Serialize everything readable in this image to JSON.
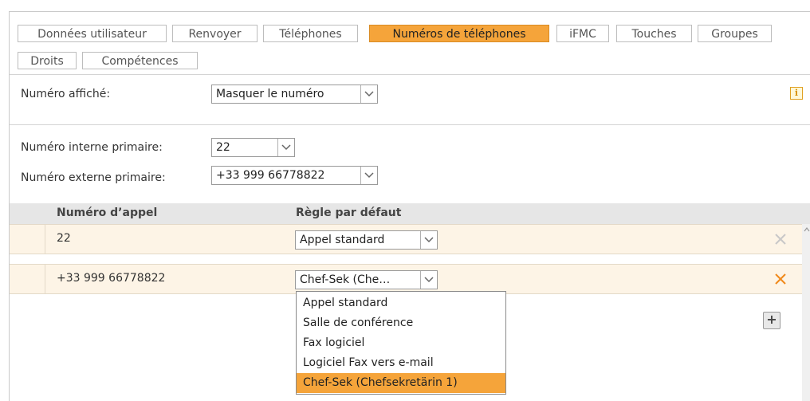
{
  "tabs": [
    {
      "label": "Données utilisateur"
    },
    {
      "label": "Renvoyer"
    },
    {
      "label": "Téléphones"
    },
    {
      "label": "Numéros de téléphones",
      "active": true
    },
    {
      "label": "iFMC"
    },
    {
      "label": "Touches"
    },
    {
      "label": "Groupes"
    },
    {
      "label": "Droits"
    },
    {
      "label": "Compétences"
    }
  ],
  "caller_id": {
    "label": "Numéro affiché:",
    "value": "Masquer le numéro"
  },
  "primary": {
    "internal_label": "Numéro interne primaire:",
    "internal_value": "22",
    "external_label": "Numéro externe primaire:",
    "external_value": "+33 999 66778822"
  },
  "table": {
    "columns": [
      "Numéro d’appel",
      "Règle par défaut"
    ],
    "rows": [
      {
        "number": "22",
        "rule": "Appel standard"
      },
      {
        "number": "+33 999 66778822",
        "rule": "Chef-Sek (Che…"
      }
    ]
  },
  "dropdown": {
    "options": [
      "Appel standard",
      "Salle de conférence",
      "Fax logiciel",
      "Logiciel Fax vers e-mail",
      "Chef-Sek (Chefsekretärin 1)"
    ],
    "selected_index": 4
  },
  "icons": {
    "info": "info-icon",
    "delete": "close-icon",
    "add": "plus-icon"
  },
  "info_glyph": "i",
  "add_glyph": "+",
  "colors": {
    "accent": "#f5a43a",
    "row_bg": "#fdf4e6",
    "header_bg": "#e6e6e6",
    "delete_active": "#f08a1c",
    "delete_inactive": "#c8c8c8"
  }
}
